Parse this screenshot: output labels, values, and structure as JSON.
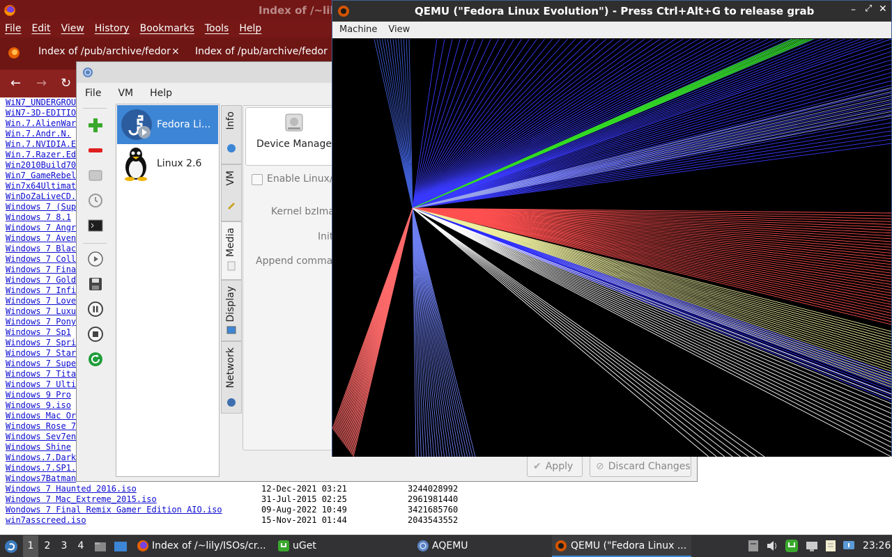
{
  "firefox": {
    "title": "Index of /~lily/",
    "menu": [
      "File",
      "Edit",
      "View",
      "History",
      "Bookmarks",
      "Tools",
      "Help"
    ],
    "tabs": [
      "Index of /pub/archive/fedora",
      "Index of /pub/archive/fedora"
    ],
    "tab_close": "×",
    "listing": [
      {
        "name": "WiN7_UNDERGROU",
        "date": "",
        "size": ""
      },
      {
        "name": "WiN7-3D-EDITIO",
        "date": "",
        "size": ""
      },
      {
        "name": "Win.7.AlienWar",
        "date": "",
        "size": ""
      },
      {
        "name": "Win.7.Andr.N.",
        "date": "",
        "size": ""
      },
      {
        "name": "Win.7.NVIDIA.E",
        "date": "",
        "size": ""
      },
      {
        "name": "Win.7.Razer.Ed",
        "date": "",
        "size": ""
      },
      {
        "name": "Win2010Build70",
        "date": "",
        "size": ""
      },
      {
        "name": "Win7_GameRebel",
        "date": "",
        "size": ""
      },
      {
        "name": "Win7x64Ultimat",
        "date": "",
        "size": ""
      },
      {
        "name": "WinDoZaLiveCD.",
        "date": "",
        "size": ""
      },
      {
        "name": "Windows 7 (Sup",
        "date": "",
        "size": ""
      },
      {
        "name": "Windows 7 8.1",
        "date": "",
        "size": ""
      },
      {
        "name": "Windows 7 Angr",
        "date": "",
        "size": ""
      },
      {
        "name": "Windows 7 Aven",
        "date": "",
        "size": ""
      },
      {
        "name": "Windows 7 Blac",
        "date": "",
        "size": ""
      },
      {
        "name": "Windows 7 Coll",
        "date": "",
        "size": ""
      },
      {
        "name": "Windows 7 Fina",
        "date": "",
        "size": ""
      },
      {
        "name": "Windows 7 Gold",
        "date": "",
        "size": ""
      },
      {
        "name": "Windows 7 Infi",
        "date": "",
        "size": ""
      },
      {
        "name": "Windows 7 Love",
        "date": "",
        "size": ""
      },
      {
        "name": "Windows 7 Luxu",
        "date": "",
        "size": ""
      },
      {
        "name": "Windows 7 Pony",
        "date": "",
        "size": ""
      },
      {
        "name": "Windows 7 Sp1",
        "date": "",
        "size": ""
      },
      {
        "name": "Windows 7 Spri",
        "date": "",
        "size": ""
      },
      {
        "name": "Windows 7 Star",
        "date": "",
        "size": ""
      },
      {
        "name": "Windows 7 Supe",
        "date": "",
        "size": ""
      },
      {
        "name": "Windows 7 Tita",
        "date": "",
        "size": ""
      },
      {
        "name": "Windows 7 Ulti",
        "date": "",
        "size": ""
      },
      {
        "name": "Windows 9 Pro",
        "date": "",
        "size": ""
      },
      {
        "name": "Windows 9.iso",
        "date": "",
        "size": ""
      },
      {
        "name": "Windows Mac Or",
        "date": "",
        "size": ""
      },
      {
        "name": "Windows Rose 7",
        "date": "",
        "size": ""
      },
      {
        "name": "Windows Sev7en",
        "date": "",
        "size": ""
      },
      {
        "name": "Windows Shine",
        "date": "",
        "size": ""
      },
      {
        "name": "Windows.7.Dark",
        "date": "",
        "size": ""
      },
      {
        "name": "Windows.7.SP1.",
        "date": "",
        "size": ""
      },
      {
        "name": "Windows7Batman",
        "date": "",
        "size": ""
      },
      {
        "name": "Windows 7 Haunted 2016.iso",
        "date": "12-Dec-2021 03:21",
        "size": "3244028992"
      },
      {
        "name": "Windows 7 Mac_Extreme_2015.iso",
        "date": "31-Jul-2015 02:25",
        "size": "2961981440"
      },
      {
        "name": "Wondows 7 Final Remix Gamer Edition AIO.iso",
        "date": "09-Aug-2022 10:49",
        "size": "3421685760"
      },
      {
        "name": "win7asscreed.iso",
        "date": "15-Nov-2021 01:44",
        "size": "2043543552"
      }
    ]
  },
  "aqemu": {
    "menu": [
      "File",
      "VM",
      "Help"
    ],
    "vms": [
      {
        "label": "Fedora Li...",
        "selected": true
      },
      {
        "label": "Linux 2.6",
        "selected": false
      }
    ],
    "tabs": [
      "Info",
      "VM",
      "Media",
      "Display",
      "Network"
    ],
    "active_tab": "Media",
    "device_manager": "Device Manager",
    "enable_linux_label": "Enable Linux/I",
    "kernel_label": "Kernel bzImag",
    "initrd_label": "Init",
    "append_label": "Append comma",
    "apply": "Apply",
    "discard": "Discard Changes"
  },
  "qemu": {
    "title": "QEMU (\"Fedora Linux Evolution\") - Press Ctrl+Alt+G to release grab",
    "menu": [
      "Machine",
      "View"
    ]
  },
  "taskbar": {
    "workspaces": [
      "1",
      "2",
      "3",
      "4"
    ],
    "apps": [
      {
        "label": "Index of /~lily/ISOs/cr...",
        "icon": "firefox-icon"
      },
      {
        "label": "uGet",
        "icon": "uget-icon"
      },
      {
        "label": "AQEMU",
        "icon": "aqemu-icon"
      },
      {
        "label": "QEMU (\"Fedora Linux ...",
        "icon": "qemu-icon"
      }
    ],
    "clock": "23:26"
  },
  "colors": {
    "firefox_chrome": "#751816",
    "selection": "#3d86d6",
    "taskbar": "#323234"
  }
}
